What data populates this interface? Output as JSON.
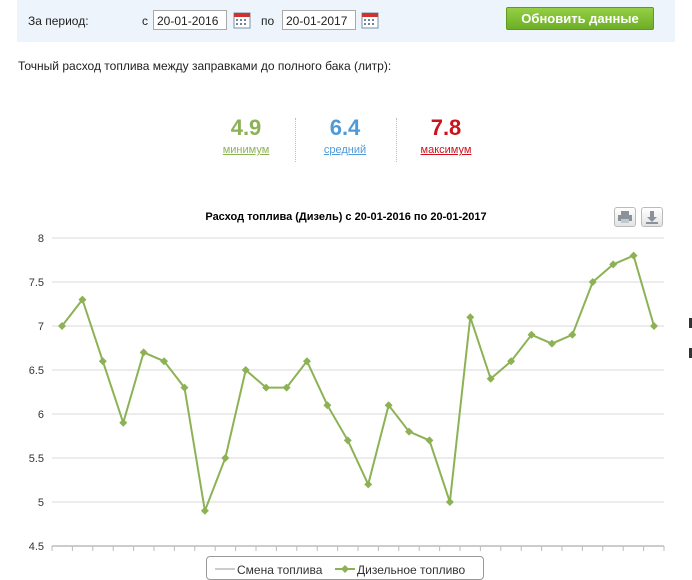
{
  "filter": {
    "period_label": "За период:",
    "from_label": "с",
    "from_value": "20-01-2016",
    "to_label": "по",
    "to_value": "20-01-2017",
    "refresh_label": "Обновить данные"
  },
  "description": "Точный расход топлива между заправками до полного бака (литр):",
  "stats": {
    "min": {
      "value": "4.9",
      "label": "минимум",
      "color": "#8db255"
    },
    "avg": {
      "value": "6.4",
      "label": "средний",
      "color": "#4f9ad8"
    },
    "max": {
      "value": "7.8",
      "label": "максимум",
      "color": "#d0101b"
    }
  },
  "chart_data": {
    "type": "line",
    "title": "Расход топлива (Дизель) с 20-01-2016 по 20-01-2017",
    "ylim": [
      4.5,
      8
    ],
    "yticks": [
      "4.5",
      "5",
      "5.5",
      "6",
      "6.5",
      "7",
      "7.5",
      "8"
    ],
    "grid": true,
    "legend_position": "bottom",
    "series": [
      {
        "name": "Смена топлива",
        "color": "#bbbbbb",
        "values": []
      },
      {
        "name": "Дизельное топливо",
        "color": "#8db255",
        "values": [
          7.0,
          7.3,
          6.6,
          5.9,
          6.7,
          6.6,
          6.3,
          4.9,
          5.5,
          6.5,
          6.3,
          6.3,
          6.6,
          6.1,
          5.7,
          5.2,
          6.1,
          5.8,
          5.7,
          5.0,
          7.1,
          6.4,
          6.6,
          6.9,
          6.8,
          6.9,
          7.5,
          7.7,
          7.8,
          7.0
        ]
      }
    ]
  }
}
